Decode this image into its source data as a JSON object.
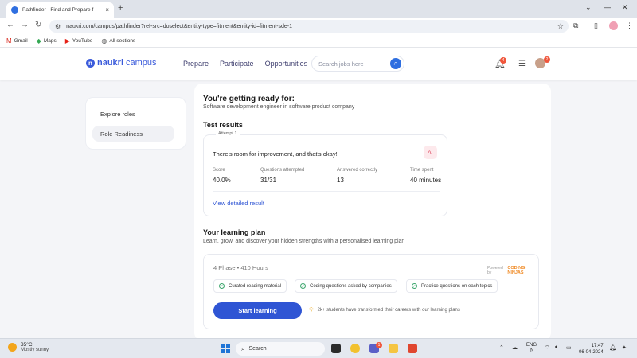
{
  "browser": {
    "tab_title": "Pathfinder - Find and Prepare f",
    "tab_close": "×",
    "new_tab": "+",
    "url": "naukri.com/campus/pathfinder?ref-src=doselect&entity-type=fitment&entity-id=fitment-sde-1",
    "bookmarks": [
      {
        "label": "Gmail",
        "icon": "M",
        "color": "#d93025"
      },
      {
        "label": "Maps",
        "icon": "◆",
        "color": "#34a853"
      },
      {
        "label": "YouTube",
        "icon": "▶",
        "color": "#e62117"
      },
      {
        "label": "All sections",
        "icon": "◍",
        "color": "#555555"
      }
    ]
  },
  "header": {
    "logo_brand": "naukri",
    "logo_sub": "campus",
    "nav": [
      "Prepare",
      "Participate",
      "Opportunities"
    ],
    "search_placeholder": "Search jobs here",
    "notif_count": "4",
    "avatar_count": "2"
  },
  "sidebar": {
    "items": [
      {
        "label": "Explore roles",
        "active": false
      },
      {
        "label": "Role Readiness",
        "active": true
      }
    ]
  },
  "main": {
    "title": "You're getting ready for:",
    "subtitle": "Software development engineer in software product company",
    "test_results_heading": "Test results",
    "attempt_label": "Attempt 1",
    "improvement_msg": "There's room for improvement, and that's okay!",
    "stats": [
      {
        "label": "Score",
        "value": "40.0%"
      },
      {
        "label": "Questions attempted",
        "value": "31/31"
      },
      {
        "label": "Answered correctly",
        "value": "13"
      },
      {
        "label": "Time spent",
        "value": "40 minutes"
      }
    ],
    "view_result_link": "View detailed result",
    "learning_heading": "Your learning plan",
    "learning_sub": "Learn, grow, and discover your hidden strengths with a personalised learning plan",
    "phase_info": "4 Phase  •  410 Hours",
    "powered_by": "Powered by",
    "powered_brand": "CODING NINJAS",
    "chips": [
      "Curated reading material",
      "Coding questions asked by companies",
      "Practice questions on each topics"
    ],
    "start_button": "Start learning",
    "tip_text": "2k+ students have transformed their careers with our learning plans"
  },
  "taskbar": {
    "temperature": "35°C",
    "weather": "Mostly sunny",
    "search_label": "Search",
    "lang_line1": "ENG",
    "lang_line2": "IN",
    "time": "17:47",
    "date": "06-04-2024",
    "teams_badge": "1"
  },
  "colors": {
    "accent": "#2f55d4",
    "brand": "#3b5bdb",
    "badge": "#f0553b"
  }
}
